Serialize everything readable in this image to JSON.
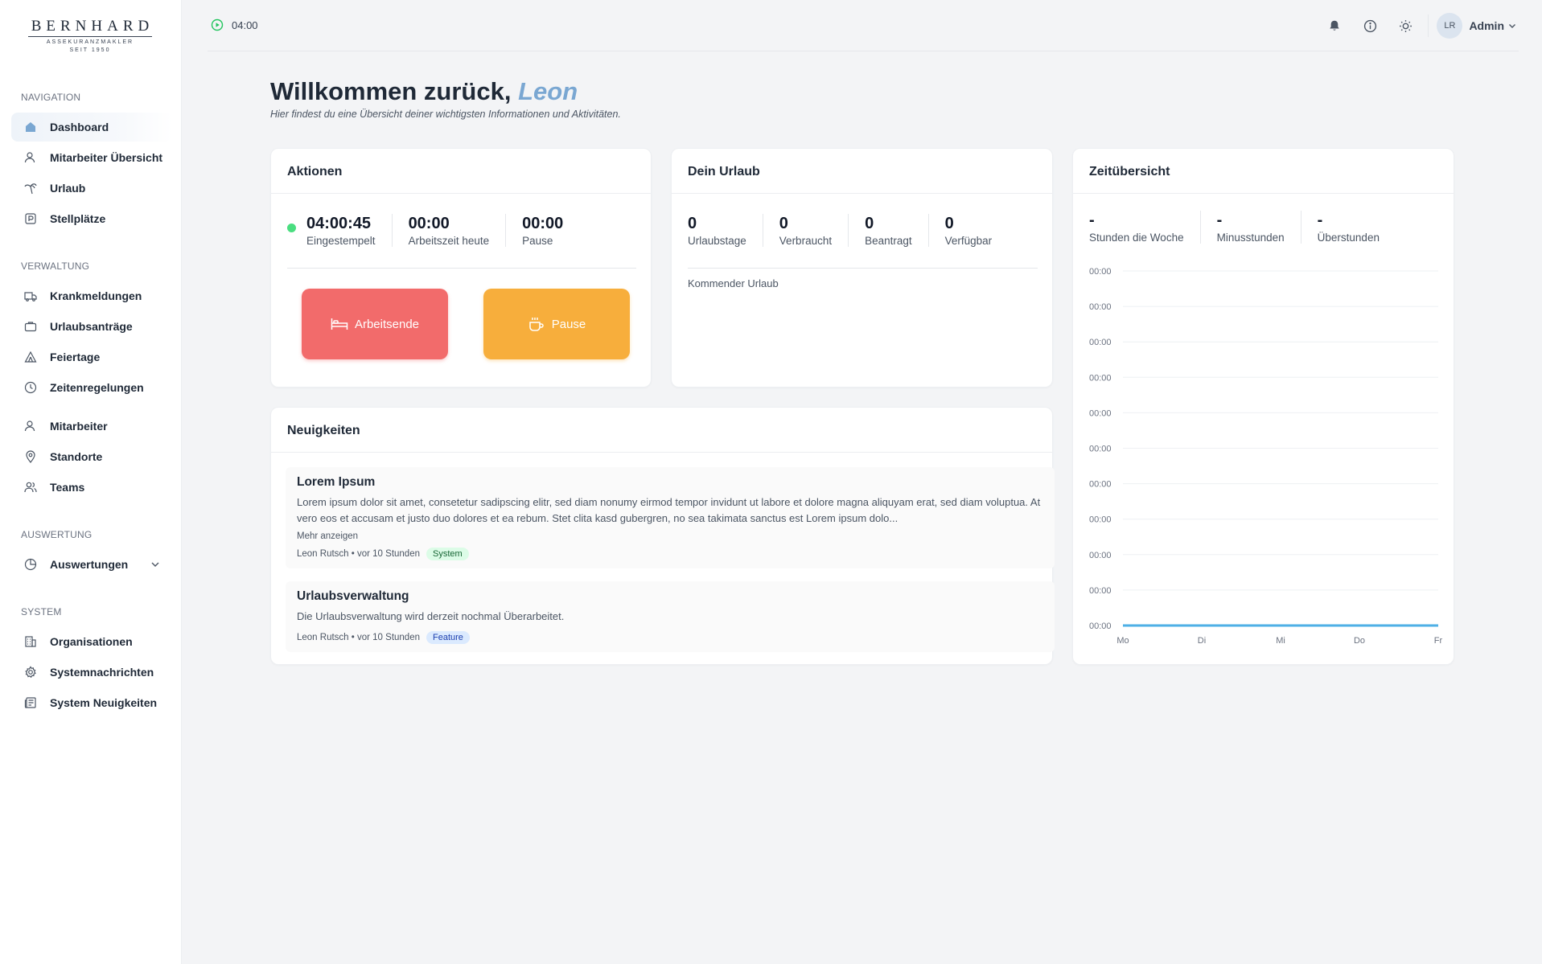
{
  "brand": {
    "logo_main": "BERNHARD",
    "logo_sub": "ASSEKURANZMAKLER",
    "logo_since": "SEIT 1950"
  },
  "sidebar": {
    "sections": [
      {
        "title": "NAVIGATION",
        "items": [
          {
            "label": "Dashboard",
            "icon": "home-icon",
            "active": true
          },
          {
            "label": "Mitarbeiter Übersicht",
            "icon": "user-icon"
          },
          {
            "label": "Urlaub",
            "icon": "palm-tree-icon"
          },
          {
            "label": "Stellplätze",
            "icon": "parking-icon"
          }
        ]
      },
      {
        "title": "VERWALTUNG",
        "items": [
          {
            "label": "Krankmeldungen",
            "icon": "ambulance-icon"
          },
          {
            "label": "Urlaubsanträge",
            "icon": "briefcase-icon"
          },
          {
            "label": "Feiertage",
            "icon": "tent-icon"
          },
          {
            "label": "Zeitenregelungen",
            "icon": "clock-icon"
          },
          {
            "label": "Mitarbeiter",
            "icon": "user-icon"
          },
          {
            "label": "Standorte",
            "icon": "map-pin-icon"
          },
          {
            "label": "Teams",
            "icon": "users-icon"
          }
        ]
      },
      {
        "title": "AUSWERTUNG",
        "items": [
          {
            "label": "Auswertungen",
            "icon": "pie-chart-icon",
            "expandable": true
          }
        ]
      },
      {
        "title": "SYSTEM",
        "items": [
          {
            "label": "Organisationen",
            "icon": "building-icon"
          },
          {
            "label": "Systemnachrichten",
            "icon": "gear-icon"
          },
          {
            "label": "System Neuigkeiten",
            "icon": "newspaper-icon"
          }
        ]
      }
    ]
  },
  "topbar": {
    "timer": "04:00",
    "avatar_initials": "LR",
    "user_name": "Admin"
  },
  "header": {
    "welcome": "Willkommen zurück,",
    "name": "Leon",
    "subtitle": "Hier findest du eine Übersicht deiner wichtigsten Informationen und Aktivitäten."
  },
  "actions": {
    "title": "Aktionen",
    "stats": [
      {
        "value": "04:00:45",
        "label": "Eingestempelt"
      },
      {
        "value": "00:00",
        "label": "Arbeitszeit heute"
      },
      {
        "value": "00:00",
        "label": "Pause"
      }
    ],
    "end_label": "Arbeitsende",
    "pause_label": "Pause",
    "status_color": "#4ade80"
  },
  "vacation": {
    "title": "Dein Urlaub",
    "stats": [
      {
        "value": "0",
        "label": "Urlaubstage"
      },
      {
        "value": "0",
        "label": "Verbraucht"
      },
      {
        "value": "0",
        "label": "Beantragt"
      },
      {
        "value": "0",
        "label": "Verfügbar"
      }
    ],
    "upcoming_label": "Kommender Urlaub"
  },
  "time_overview": {
    "title": "Zeitübersicht",
    "stats": [
      {
        "value": "-",
        "label": "Stunden die Woche"
      },
      {
        "value": "-",
        "label": "Minusstunden"
      },
      {
        "value": "-",
        "label": "Überstunden"
      }
    ]
  },
  "news": {
    "title": "Neuigkeiten",
    "items": [
      {
        "title": "Lorem Ipsum",
        "text": "Lorem ipsum dolor sit amet, consetetur sadipscing elitr, sed diam nonumy eirmod tempor invidunt ut labore et dolore magna aliquyam erat, sed diam voluptua. At vero eos et accusam et justo duo dolores et ea rebum. Stet clita kasd gubergren, no sea takimata sanctus est Lorem ipsum dolo...",
        "more": "Mehr anzeigen",
        "meta": "Leon Rutsch • vor 10 Stunden",
        "badge": "System"
      },
      {
        "title": "Urlaubsverwaltung",
        "text": "Die Urlaubsverwaltung wird derzeit nochmal Überarbeitet.",
        "meta": "Leon Rutsch • vor 10 Stunden",
        "badge": "Feature"
      }
    ]
  },
  "chart_data": {
    "type": "line",
    "categories": [
      "Mo",
      "Di",
      "Mi",
      "Do",
      "Fr"
    ],
    "series": [
      {
        "values": [
          0,
          0,
          0,
          0,
          0
        ]
      }
    ],
    "y_tick_labels": [
      "00:00",
      "00:00",
      "00:00",
      "00:00",
      "00:00",
      "00:00",
      "00:00",
      "00:00",
      "00:00",
      "00:00",
      "00:00"
    ],
    "grid": true,
    "line_color": "#4fb0e6"
  }
}
